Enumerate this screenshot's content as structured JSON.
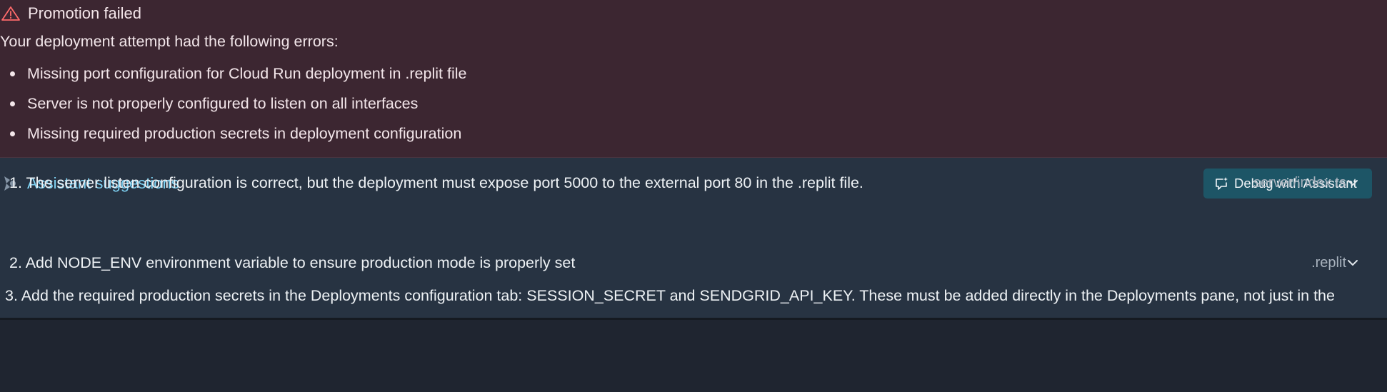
{
  "error": {
    "title": "Promotion failed",
    "intro": "Your deployment attempt had the following errors:",
    "items": [
      "Missing port configuration for Cloud Run deployment in .replit file",
      "Server is not properly configured to listen on all interfaces",
      "Missing required production secrets in deployment configuration"
    ]
  },
  "assistant": {
    "title": "Assistant suggestions",
    "debug_button": "Debug with Assistant",
    "suggestions": [
      {
        "text": "1.  The server listen configuration is correct, but the deployment must expose port 5000 to the external port 80 in the .replit file.",
        "file": "server/index.ts"
      },
      {
        "text": "2.  Add NODE_ENV environment variable to ensure production mode is properly set",
        "file": ".replit"
      },
      {
        "text": "3. Add the required production secrets in the Deployments configuration tab: SESSION_SECRET and SENDGRID_API_KEY. These must be added directly in the Deployments pane, not just in the"
      }
    ]
  },
  "colors": {
    "error_bg": "#3c2631",
    "warning_icon": "#ff6b6b",
    "assistant_bg": "#273342",
    "assistant_title": "#7fd3f4",
    "debug_button_bg": "#1d5566"
  }
}
